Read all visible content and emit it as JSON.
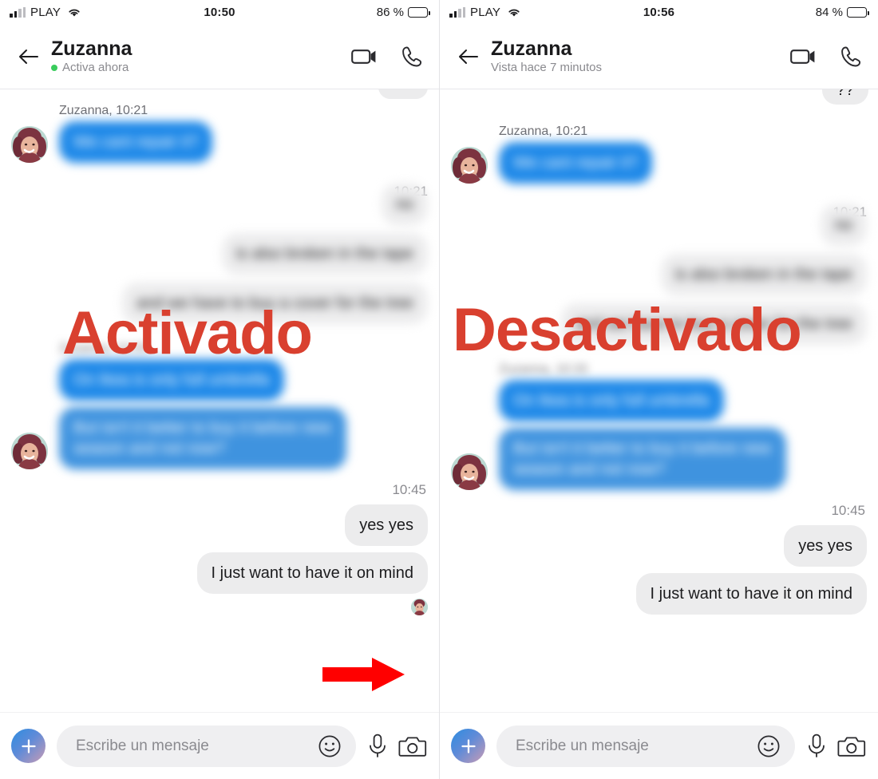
{
  "panels": [
    {
      "id": "left",
      "overlay_label": "Activado",
      "overlay_color": "#d9402f",
      "status": {
        "carrier": "PLAY",
        "time": "10:50",
        "battery_text": "86 %",
        "battery_percent": 86,
        "signal_bars_active": 2,
        "signal_bars_total": 4,
        "wifi_icon": "wifi-icon",
        "battery_icon": "battery-icon"
      },
      "header": {
        "back_icon": "arrow-left-icon",
        "name": "Zuzanna",
        "subtitle": "Activa ahora",
        "online": true,
        "video_icon": "video-camera-icon",
        "call_icon": "phone-icon"
      },
      "messages": [
        {
          "type": "sender_label",
          "text": "Zuzanna, 10:21"
        },
        {
          "type": "them_blue",
          "text": "We cant repair it?",
          "blurred": true
        },
        {
          "type": "timestamp_partial",
          "text": "10:21"
        },
        {
          "type": "me_grey_short",
          "text": "no",
          "blurred": true
        },
        {
          "type": "me_grey",
          "text": "is also broken in the tape",
          "blurred": true
        },
        {
          "type": "me_grey",
          "text": "and we have to buy a cover for the tree",
          "blurred": true
        },
        {
          "type": "sender_label",
          "text": "Zuzanna, 10:33",
          "blurred": true
        },
        {
          "type": "them_blue",
          "text": "On Ikea is only full umbrella",
          "blurred": true
        },
        {
          "type": "them_blue2",
          "text": "But isn't it better to buy it before new season and not now?",
          "blurred": true
        },
        {
          "type": "timestamp",
          "text": "10:45"
        },
        {
          "type": "me_grey_clear",
          "text": "yes yes"
        },
        {
          "type": "me_grey_clear",
          "text": "I just want to have it on mind"
        }
      ],
      "read_receipt": {
        "visible": true,
        "name": "read-receipt-avatar"
      },
      "annotation_arrow": {
        "visible": true,
        "color": "#ff0000",
        "name": "red-arrow-annotation"
      },
      "composer": {
        "plus_icon": "plus-icon",
        "placeholder": "Escribe un mensaje",
        "emoji_icon": "smiley-icon",
        "mic_icon": "microphone-icon",
        "camera_icon": "camera-icon"
      }
    },
    {
      "id": "right",
      "overlay_label": "Desactivado",
      "overlay_color": "#d9402f",
      "status": {
        "carrier": "PLAY",
        "time": "10:56",
        "battery_text": "84 %",
        "battery_percent": 84,
        "signal_bars_active": 2,
        "signal_bars_total": 4,
        "wifi_icon": "wifi-icon",
        "battery_icon": "battery-icon"
      },
      "header": {
        "back_icon": "arrow-left-icon",
        "name": "Zuzanna",
        "subtitle": "Vista hace 7 minutos",
        "online": false,
        "video_icon": "video-camera-icon",
        "call_icon": "phone-icon"
      },
      "top_partial_bubble": "??",
      "messages": [
        {
          "type": "sender_label",
          "text": "Zuzanna, 10:21"
        },
        {
          "type": "them_blue",
          "text": "We cant repair it?",
          "blurred": true
        },
        {
          "type": "timestamp_partial",
          "text": "10:21"
        },
        {
          "type": "me_grey_short",
          "text": "no",
          "blurred": true
        },
        {
          "type": "me_grey",
          "text": "is also broken in the tape",
          "blurred": true
        },
        {
          "type": "me_grey",
          "text": "and we have to buy a cover for the tree",
          "blurred": true
        },
        {
          "type": "sender_label",
          "text": "Zuzanna, 10:33",
          "blurred": true
        },
        {
          "type": "them_blue",
          "text": "On Ikea is only full umbrella",
          "blurred": true
        },
        {
          "type": "them_blue2",
          "text": "But isn't it better to buy it before new season and not now?",
          "blurred": true
        },
        {
          "type": "timestamp",
          "text": "10:45"
        },
        {
          "type": "me_grey_clear",
          "text": "yes yes"
        },
        {
          "type": "me_grey_clear",
          "text": "I just want to have it on mind"
        }
      ],
      "read_receipt": {
        "visible": false,
        "name": "read-receipt-avatar"
      },
      "annotation_arrow": {
        "visible": false,
        "color": "#ff0000",
        "name": "red-arrow-annotation"
      },
      "composer": {
        "plus_icon": "plus-icon",
        "placeholder": "Escribe un mensaje",
        "emoji_icon": "smiley-icon",
        "mic_icon": "microphone-icon",
        "camera_icon": "camera-icon"
      }
    }
  ],
  "colors": {
    "bubble_incoming_blue": "#1d88e8",
    "bubble_incoming_blue_alt": "#3f93df",
    "bubble_outgoing_grey": "#ececed",
    "annotation_red": "#d9402f",
    "arrow_red": "#ff0000",
    "online_green": "#3acc5c"
  }
}
